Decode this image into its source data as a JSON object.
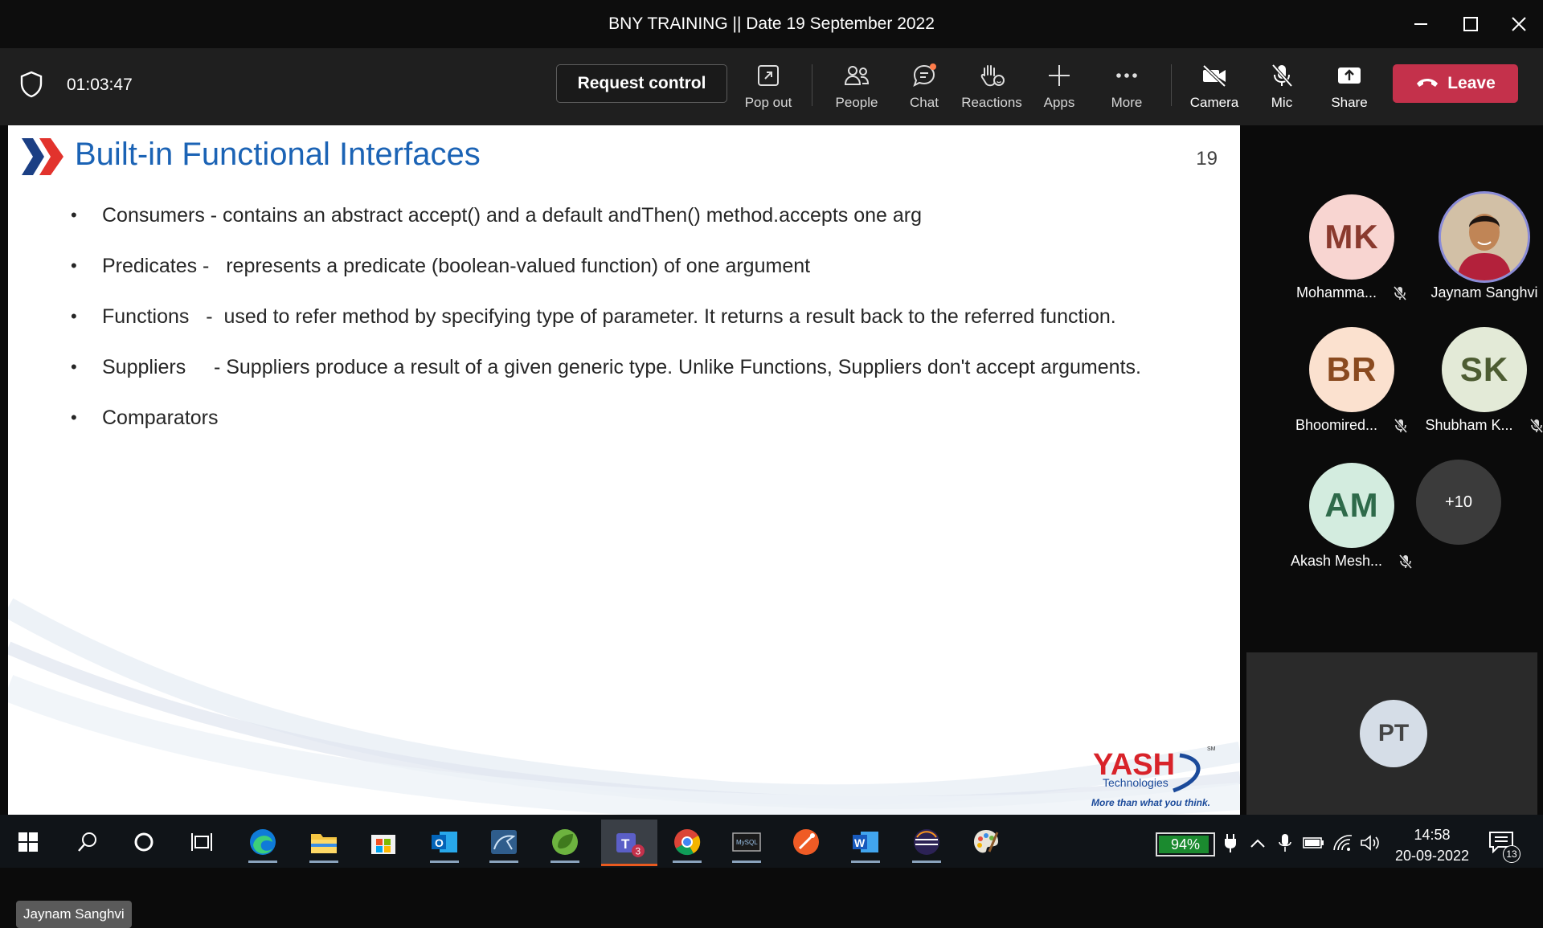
{
  "window": {
    "title": "BNY TRAINING || Date 19 September 2022"
  },
  "meeting": {
    "timer": "01:03:47",
    "request_control": "Request control",
    "tools": {
      "popout": "Pop out",
      "people": "People",
      "chat": "Chat",
      "reactions": "Reactions",
      "apps": "Apps",
      "more": "More",
      "camera": "Camera",
      "mic": "Mic",
      "share": "Share"
    },
    "leave": "Leave",
    "accent_color": "#c4314b"
  },
  "slide": {
    "title": "Built-in Functional Interfaces",
    "page_number": "19",
    "bullets": [
      "Consumers - contains an abstract accept() and a default andThen() method.accepts one arg",
      "Predicates -   represents a predicate (boolean-valued function) of one argument",
      "Functions   -  used to refer method by specifying type of parameter. It returns a result back to the referred function.",
      "Suppliers     - Suppliers produce a result of a given generic type. Unlike Functions, Suppliers don't accept arguments.",
      "Comparators"
    ],
    "logo": {
      "name": "YASH",
      "subtitle": "Technologies",
      "tagline": "More than what you think.",
      "mark": "SM"
    },
    "presenter": "Jaynam Sanghvi",
    "title_color": "#1b63b5"
  },
  "participants": [
    {
      "initials": "MK",
      "name": "Mohamma...",
      "muted": true,
      "bg": "#f8d5d1",
      "fg": "#8a3a2e"
    },
    {
      "initials": "",
      "name": "Jaynam Sanghvi",
      "muted": false,
      "photo": true
    },
    {
      "initials": "BR",
      "name": "Bhoomired...",
      "muted": true,
      "bg": "#fbe1cf",
      "fg": "#8a4a1f"
    },
    {
      "initials": "SK",
      "name": "Shubham K...",
      "muted": true,
      "bg": "#e3ead7",
      "fg": "#4d5c32"
    },
    {
      "initials": "AM",
      "name": "Akash Mesh...",
      "muted": true,
      "bg": "#d3ecdf",
      "fg": "#2e6a4a"
    }
  ],
  "more_participants": "+10",
  "self_view": {
    "initials": "PT"
  },
  "taskbar": {
    "teams_badge": "3",
    "battery_percent": 94,
    "battery_label": "94%",
    "time": "14:58",
    "date": "20-09-2022",
    "notifications": "13"
  }
}
